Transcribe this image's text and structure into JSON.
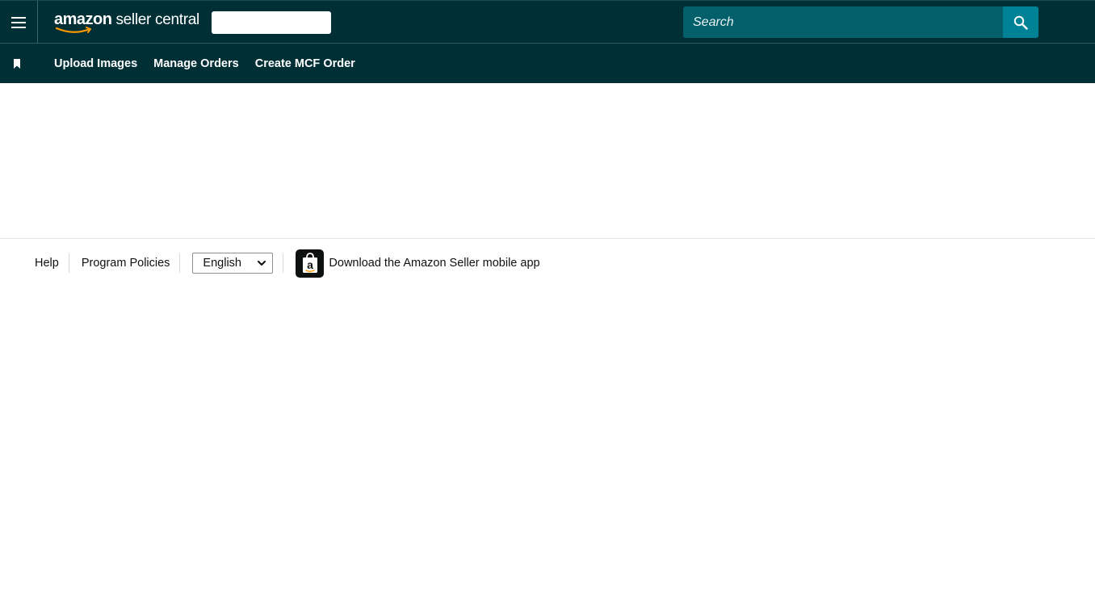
{
  "header": {
    "logo_brand": "amazon",
    "logo_suffix": " seller central",
    "search": {
      "placeholder": "Search"
    }
  },
  "nav": {
    "links": [
      {
        "label": "Upload Images"
      },
      {
        "label": "Manage Orders"
      },
      {
        "label": "Create MCF Order"
      }
    ]
  },
  "footer": {
    "help": "Help",
    "program_policies": "Program Policies",
    "language": {
      "selected": "English"
    },
    "app_link": "Download the Amazon Seller mobile app"
  },
  "icons": {
    "menu": "hamburger-menu-icon",
    "search": "search-icon",
    "bookmark": "bookmark-icon",
    "app": "amazon-app-icon"
  },
  "colors": {
    "header_bg": "#002f36",
    "search_bg": "#03606b",
    "search_button": "#008296",
    "accent_smile": "#ff9900"
  }
}
